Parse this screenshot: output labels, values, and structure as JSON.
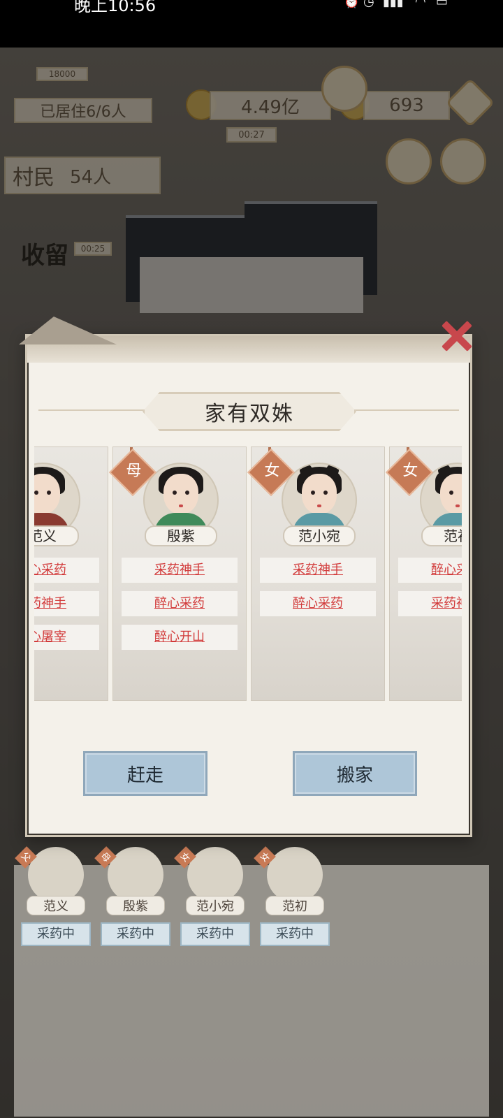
{
  "status_bar": {
    "time": "晚上10:56"
  },
  "hud": {
    "resident_label": "已居住6/6人",
    "copper_amount": "4.49亿",
    "gold_amount": "693",
    "villagers_label": "村民",
    "villagers_count": "54人",
    "shelter_label": "收留",
    "small_value_1": "18000",
    "timer_1": "00:27",
    "timer_2": "00:25"
  },
  "modal": {
    "title": "家有双姝",
    "cards": [
      {
        "badge": "",
        "name": "范义",
        "skills": [
          "醉心采药",
          "采药神手",
          "醉心屠宰"
        ]
      },
      {
        "badge": "母",
        "name": "殷紫",
        "skills": [
          "采药神手",
          "醉心采药",
          "醉心开山"
        ]
      },
      {
        "badge": "女",
        "name": "范小宛",
        "skills": [
          "采药神手",
          "醉心采药"
        ]
      },
      {
        "badge": "女",
        "name": "范初",
        "skills": [
          "醉心采药",
          "采药神手"
        ]
      }
    ],
    "buttons": {
      "evict": "赶走",
      "move": "搬家"
    }
  },
  "family_row": [
    {
      "badge": "父",
      "name": "范义",
      "status": "采药中"
    },
    {
      "badge": "母",
      "name": "殷紫",
      "status": "采药中"
    },
    {
      "badge": "女",
      "name": "范小宛",
      "status": "采药中"
    },
    {
      "badge": "女",
      "name": "范初",
      "status": "采药中"
    }
  ],
  "colors": {
    "skill_link": "#d23b3b",
    "button_blue": "#aec6d8",
    "badge_orange": "#c67a56",
    "close_red": "#c8474c"
  }
}
